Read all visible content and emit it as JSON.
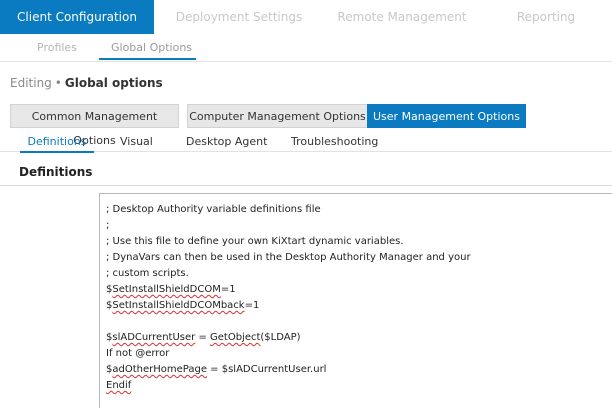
{
  "topnav": {
    "tabs": [
      {
        "label": "Client Configuration",
        "active": true
      },
      {
        "label": "Deployment Settings",
        "active": false
      },
      {
        "label": "Remote Management",
        "active": false
      },
      {
        "label": "Reporting",
        "active": false
      }
    ]
  },
  "subnav": {
    "items": [
      {
        "label": "Profiles",
        "active": false
      },
      {
        "label": "Global Options",
        "active": true
      }
    ]
  },
  "editing": {
    "label": "Editing",
    "separator": "•",
    "value": "Global options"
  },
  "option_tabs": [
    {
      "label": "Common Management Options",
      "active": false
    },
    {
      "label": "Computer Management Options",
      "active": false
    },
    {
      "label": "User Management Options",
      "active": true
    }
  ],
  "inner_tabs": [
    {
      "label": "Definitions",
      "active": true
    },
    {
      "label": "Visual",
      "active": false
    },
    {
      "label": "Desktop Agent",
      "active": false
    },
    {
      "label": "Troubleshooting",
      "active": false
    }
  ],
  "section": {
    "title": "Definitions"
  },
  "editor": {
    "lines": {
      "l1": "; Desktop Authority variable definitions file",
      "l2": ";",
      "l3": "; Use this file to define your own KiXtart dynamic variables.",
      "l4": "; DynaVars can then be used in the Desktop Authority Manager and your",
      "l5": "; custom scripts.",
      "l6a": "$",
      "l6b": "SetInstallShieldDCOM",
      "l6c": "=1",
      "l7a": "$",
      "l7b": "SetInstallShieldDCOMback",
      "l7c": "=1",
      "l8": "",
      "l9a": "$",
      "l9b": "slADCurrentUser",
      "l9c": " = ",
      "l9d": "GetObject",
      "l9e": "($LDAP)",
      "l10": "If not @error",
      "l11a": "$",
      "l11b": "adOtherHomePage",
      "l11c": " = $slADCurrentUser.url",
      "l12": "Endif"
    }
  },
  "colors": {
    "accent": "#0a7bc1",
    "tab_inactive_bg": "#e7e7e7",
    "spellcheck": "#d93030"
  }
}
